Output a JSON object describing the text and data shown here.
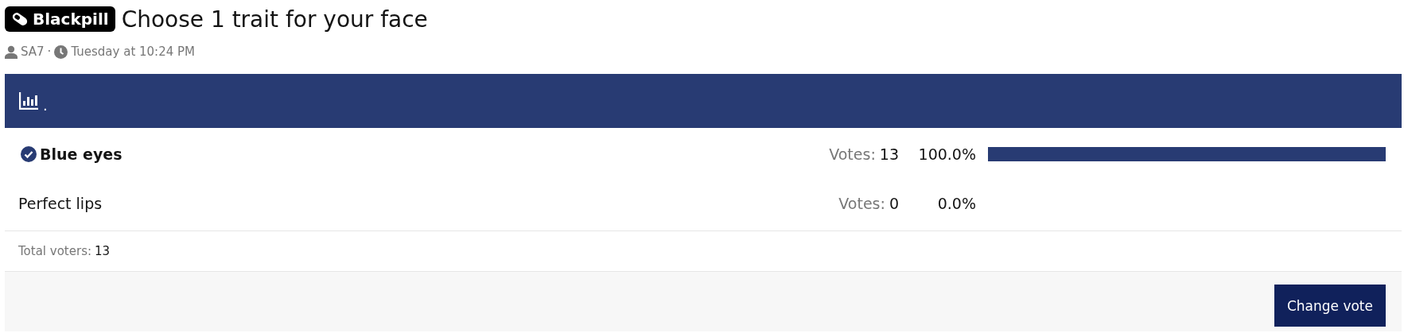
{
  "thread": {
    "prefix": "Blackpill",
    "title": "Choose 1 trait for your face",
    "author": "SA7",
    "separator": "·",
    "time": "Tuesday at 10:24 PM"
  },
  "poll": {
    "question": ".",
    "options": [
      {
        "label": "Blue eyes",
        "selected": true,
        "votes_label": "Votes:",
        "votes": "13",
        "percent": "100.0%",
        "level": 1
      },
      {
        "label": "Perfect lips",
        "selected": false,
        "votes_label": "Votes:",
        "votes": "0",
        "percent": "0.0%"
      }
    ],
    "total_label": "Total voters:",
    "total": "13",
    "button": "Change vote"
  }
}
